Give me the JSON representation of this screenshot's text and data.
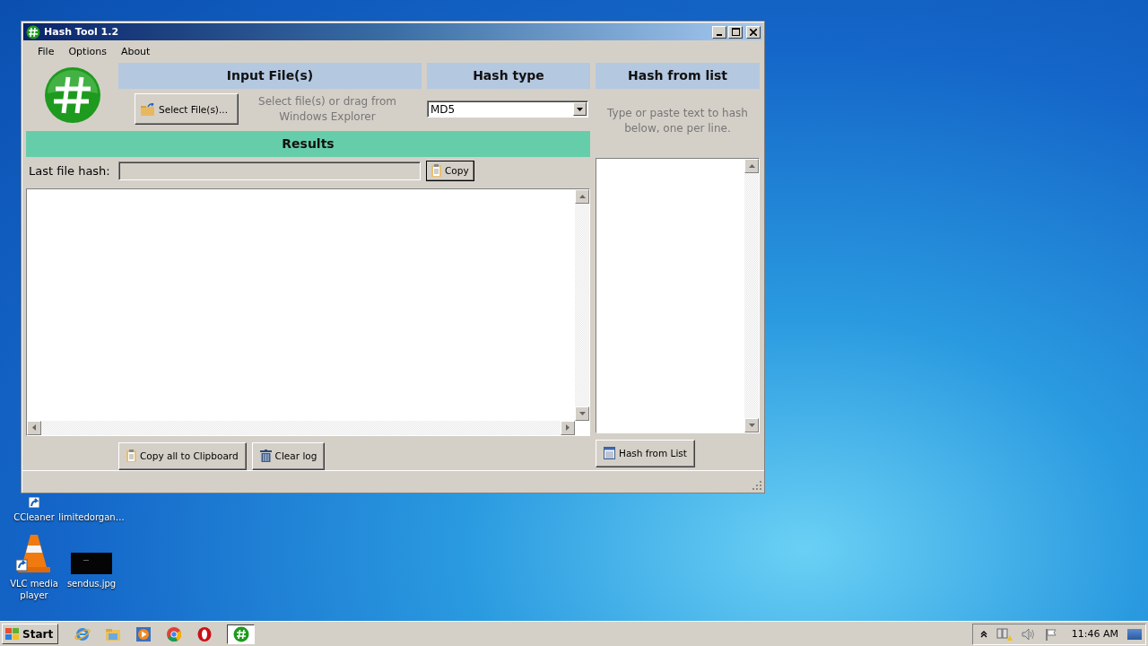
{
  "window": {
    "title": "Hash Tool 1.2"
  },
  "menu": [
    "File",
    "Options",
    "About"
  ],
  "input_section": {
    "heading": "Input File(s)",
    "button": "Select File(s)...",
    "hint": "Select file(s) or drag from Windows Explorer"
  },
  "hash_type": {
    "heading": "Hash type",
    "value": "MD5"
  },
  "hash_from_list": {
    "heading": "Hash from list",
    "hint": "Type or paste text to hash below, one per line.",
    "button": "Hash from List"
  },
  "results": {
    "heading": "Results",
    "last_hash_label": "Last file hash:",
    "copy_button": "Copy",
    "buttons": [
      "Copy all to Clipboard",
      "Clear log"
    ]
  },
  "desktop_icons": [
    {
      "label": "CCleaner",
      "kind": "shortcut"
    },
    {
      "label": "limitedorgan…",
      "kind": "file"
    },
    {
      "label": "VLC media player",
      "kind": "cone"
    },
    {
      "label": "sendus.jpg",
      "kind": "image"
    }
  ],
  "taskbar": {
    "start": "Start",
    "clock": "11:46 AM"
  }
}
